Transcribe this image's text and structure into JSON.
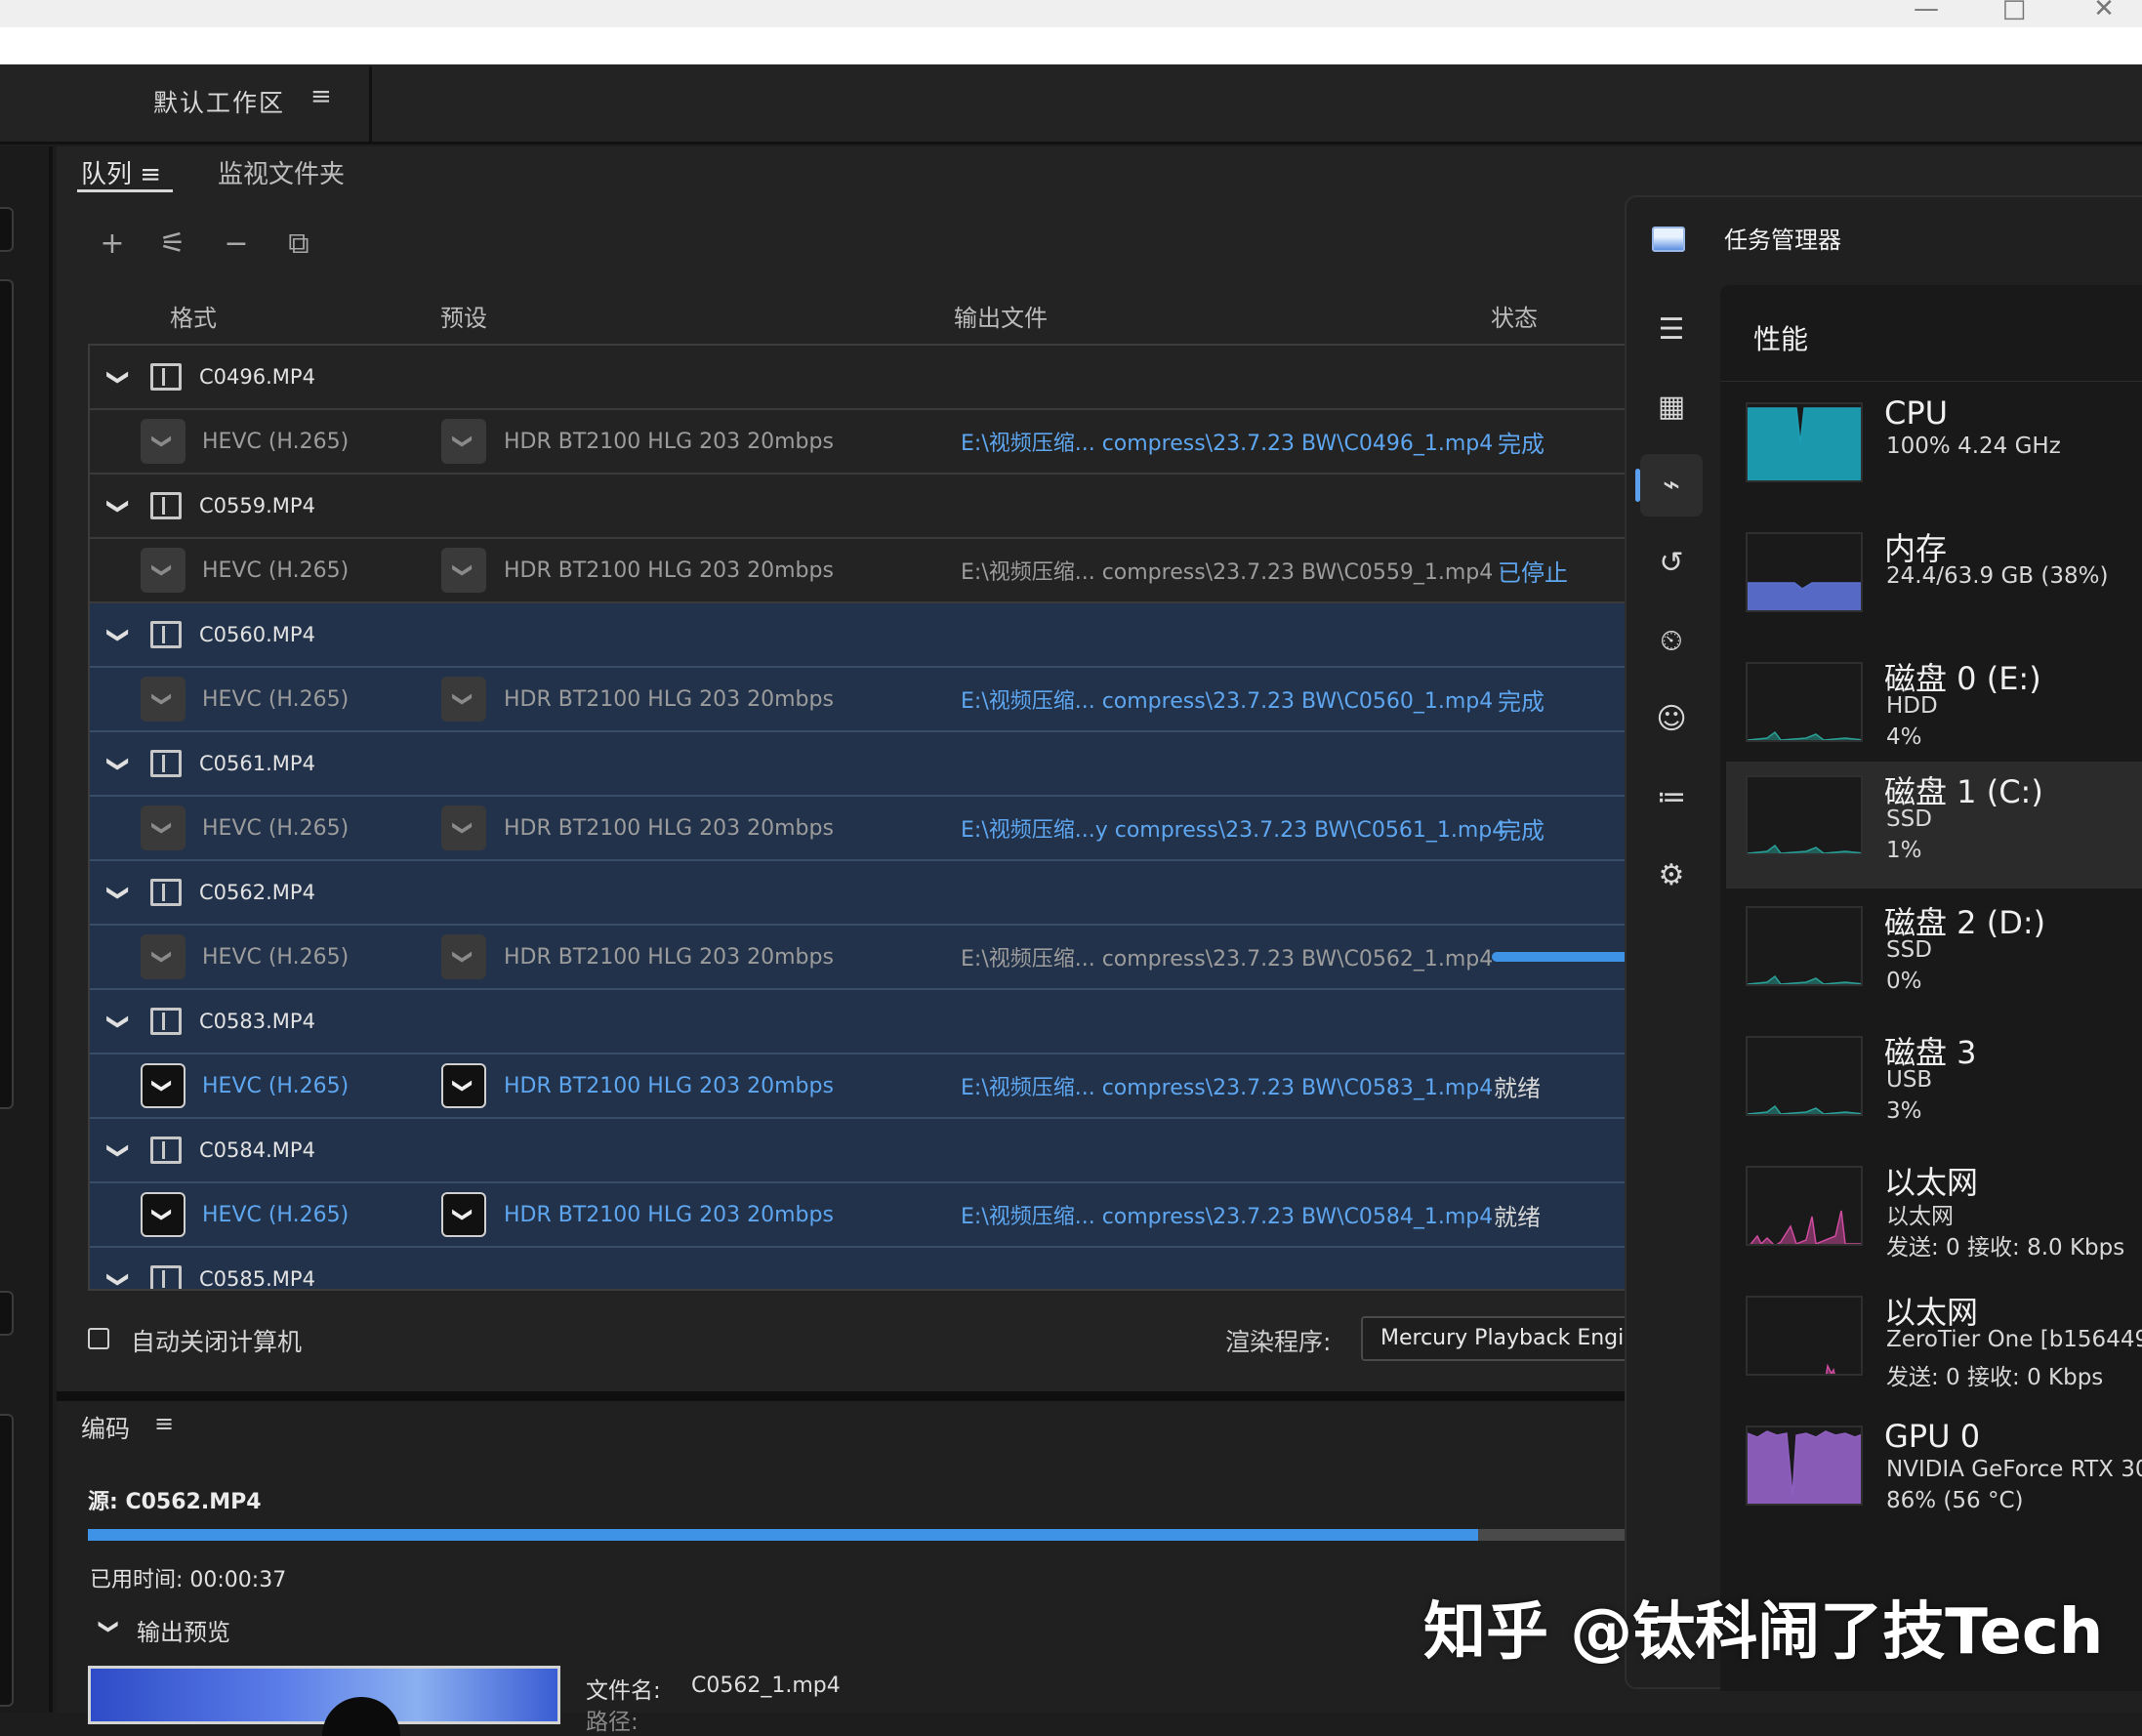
{
  "window": {
    "controls": [
      "—",
      "□",
      "✕"
    ]
  },
  "workspace": {
    "title": "默认工作区",
    "menu": "≡"
  },
  "tabs": {
    "queue": "队列 ≡",
    "watch_folders": "监视文件夹"
  },
  "toolbar": {
    "add": "+",
    "settings": "⚟",
    "remove": "−",
    "duplicate": "⧉"
  },
  "columns": {
    "format": "格式",
    "preset": "预设",
    "output": "输出文件",
    "status": "状态"
  },
  "queue": [
    {
      "file": "C0496.MP4",
      "format": "HEVC (H.265)",
      "preset": "HDR BT2100 HLG 203 20mbps",
      "output": "E:\\视频压缩... compress\\23.7.23 BW\\C0496_1.mp4",
      "status": "完成",
      "state": "done"
    },
    {
      "file": "C0559.MP4",
      "format": "HEVC (H.265)",
      "preset": "HDR BT2100 HLG 203 20mbps",
      "output": "E:\\视频压缩... compress\\23.7.23 BW\\C0559_1.mp4",
      "status": "已停止",
      "state": "stopped"
    },
    {
      "file": "C0560.MP4",
      "format": "HEVC (H.265)",
      "preset": "HDR BT2100 HLG 203 20mbps",
      "output": "E:\\视频压缩... compress\\23.7.23 BW\\C0560_1.mp4",
      "status": "完成",
      "state": "done"
    },
    {
      "file": "C0561.MP4",
      "format": "HEVC (H.265)",
      "preset": "HDR BT2100 HLG 203 20mbps",
      "output": "E:\\视频压缩...y compress\\23.7.23 BW\\C0561_1.mp4",
      "status": "完成",
      "state": "done"
    },
    {
      "file": "C0562.MP4",
      "format": "HEVC (H.265)",
      "preset": "HDR BT2100 HLG 203 20mbps",
      "output": "E:\\视频压缩... compress\\23.7.23 BW\\C0562_1.mp4",
      "status": "",
      "state": "encoding",
      "progress": 0.89
    },
    {
      "file": "C0583.MP4",
      "format": "HEVC (H.265)",
      "preset": "HDR BT2100 HLG 203 20mbps",
      "output": "E:\\视频压缩... compress\\23.7.23 BW\\C0583_1.mp4",
      "status": "就绪",
      "state": "ready"
    },
    {
      "file": "C0584.MP4",
      "format": "HEVC (H.265)",
      "preset": "HDR BT2100 HLG 203 20mbps",
      "output": "E:\\视频压缩... compress\\23.7.23 BW\\C0584_1.mp4",
      "status": "就绪",
      "state": "ready"
    },
    {
      "file": "C0585.MP4"
    }
  ],
  "footer": {
    "auto_shutdown": "自动关闭计算机",
    "renderer_label": "渲染程序:",
    "renderer_value": "Mercury Playback Engine GPU"
  },
  "encoding": {
    "title": "编码",
    "menu": "≡",
    "source": "源: C0562.MP4",
    "progress": 0.89,
    "elapsed": "已用时间: 00:00:37",
    "output_preview": "输出预览",
    "filename_label": "文件名:",
    "filename_value": "C0562_1.mp4",
    "path_label": "路径:"
  },
  "task_manager": {
    "title": "任务管理器",
    "section": "性能",
    "nav_icons": [
      "menu-icon",
      "processes-icon",
      "performance-icon",
      "app-history-icon",
      "startup-icon",
      "users-icon",
      "details-icon",
      "services-icon"
    ],
    "items": [
      {
        "name": "CPU",
        "sub1": "100% 4.24 GHz",
        "sub2": "",
        "color": "#1c9fb5"
      },
      {
        "name": "内存",
        "sub1": "24.4/63.9 GB (38%)",
        "sub2": "",
        "color": "#5a6fcf"
      },
      {
        "name": "磁盘 0 (E:)",
        "sub1": "HDD",
        "sub2": "4%",
        "color": "#2aa198"
      },
      {
        "name": "磁盘 1 (C:)",
        "sub1": "SSD",
        "sub2": "1%",
        "color": "#2aa198"
      },
      {
        "name": "磁盘 2 (D:)",
        "sub1": "SSD",
        "sub2": "0%",
        "color": "#2aa198"
      },
      {
        "name": "磁盘 3",
        "sub1": "USB",
        "sub2": "3%",
        "color": "#2aa198"
      },
      {
        "name": "以太网",
        "sub1": "以太网",
        "sub2": "发送: 0 接收: 8.0 Kbps",
        "color": "#d04ca0"
      },
      {
        "name": "以太网",
        "sub1": "ZeroTier One [b156449",
        "sub2": "发送: 0 接收: 0 Kbps",
        "color": "#d04ca0"
      },
      {
        "name": "GPU 0",
        "sub1": "NVIDIA GeForce RTX 30",
        "sub2": "86% (56 °C)",
        "color": "#8e5fbf"
      }
    ]
  },
  "watermark": "知乎 @钛科闹了技Tech"
}
